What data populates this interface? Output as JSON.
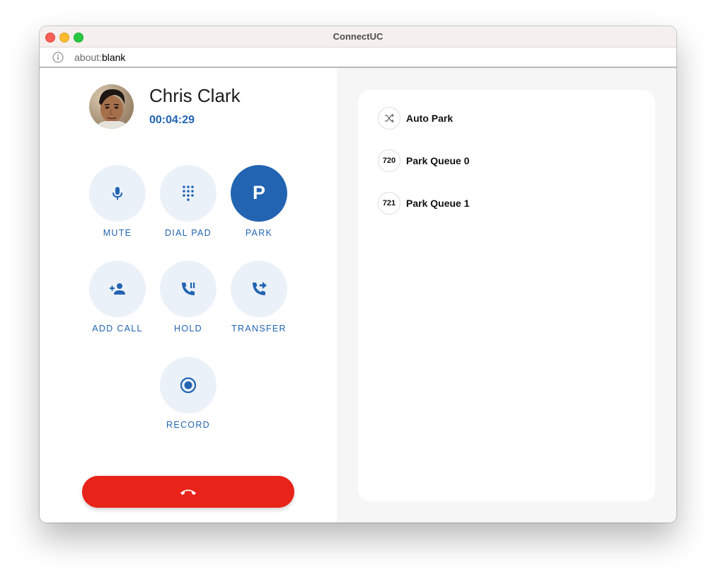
{
  "window": {
    "title": "ConnectUC"
  },
  "address_bar": {
    "scheme": "about:",
    "path": "blank"
  },
  "call": {
    "contact_name": "Chris Clark",
    "timer": "00:04:29"
  },
  "controls": [
    {
      "id": "mute",
      "label": "MUTE",
      "icon": "microphone-icon"
    },
    {
      "id": "dialpad",
      "label": "DIAL PAD",
      "icon": "dialpad-icon"
    },
    {
      "id": "park",
      "label": "PARK",
      "icon_text": "P",
      "active": true
    },
    {
      "id": "add-call",
      "label": "ADD CALL",
      "icon": "add-person-icon"
    },
    {
      "id": "hold",
      "label": "HOLD",
      "icon": "phone-paused-icon"
    },
    {
      "id": "transfer",
      "label": "TRANSFER",
      "icon": "phone-forwarded-icon"
    },
    {
      "id": "record",
      "label": "RECORD",
      "icon": "record-icon"
    }
  ],
  "hangup": {
    "icon": "end-call-icon"
  },
  "park_options": [
    {
      "badge": "",
      "icon": "shuffle-icon",
      "label": "Auto Park"
    },
    {
      "badge": "720",
      "label": "Park Queue 0"
    },
    {
      "badge": "721",
      "label": "Park Queue 1"
    }
  ],
  "colors": {
    "accent": "#2264b1",
    "control_bg": "#ebf1f8",
    "hangup": "#e8231a",
    "right_pane_bg": "#f6f6f6"
  }
}
